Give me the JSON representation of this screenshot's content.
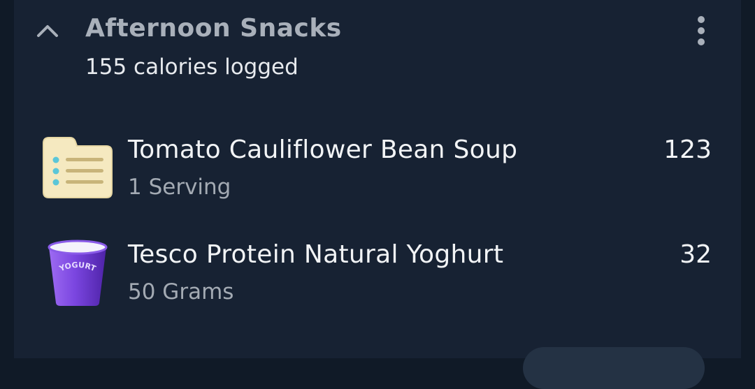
{
  "section": {
    "title": "Afternoon Snacks",
    "subtitle": "155 calories logged",
    "collapse_icon": "chevron-up-icon",
    "menu_icon": "more-vertical-icon"
  },
  "items": [
    {
      "name": "Tomato Cauliflower Bean Soup",
      "quantity": "1 Serving",
      "calories": "123",
      "icon": "recipe-card-icon"
    },
    {
      "name": "Tesco Protein Natural Yoghurt",
      "quantity": "50 Grams",
      "calories": "32",
      "icon": "yoghurt-pot-icon",
      "icon_label": "YOGURT"
    }
  ],
  "colors": {
    "background": "#101a27",
    "card": "#172233",
    "title": "#a9b0ba",
    "text": "#f2f4f6",
    "muted": "#a3aab3",
    "recipe_card": "#f5e9c0",
    "recipe_dots": "#5bc6d8",
    "yoghurt": "#7b46e0"
  }
}
